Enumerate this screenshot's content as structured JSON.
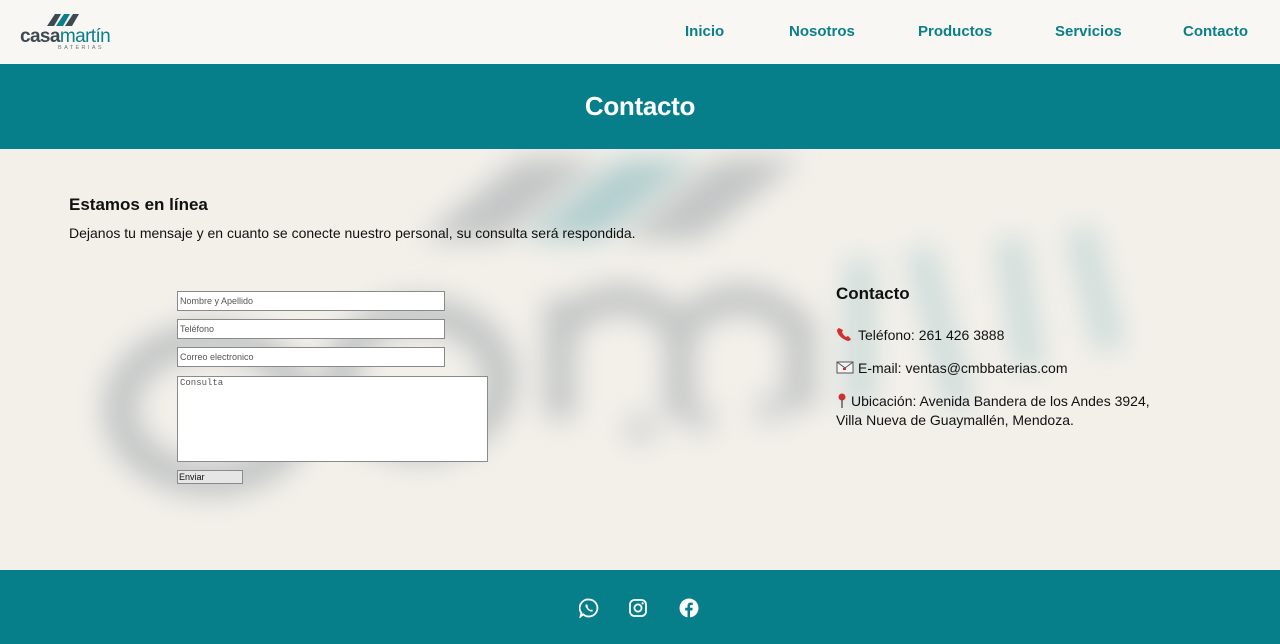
{
  "header": {
    "logo": {
      "name": "logo-casamartin",
      "word_main": "casa",
      "word_accent": "martín",
      "sub": "BATERIAS"
    },
    "nav": [
      {
        "label": "Inicio"
      },
      {
        "label": "Nosotros"
      },
      {
        "label": "Productos"
      },
      {
        "label": "Servicios"
      },
      {
        "label": "Contacto"
      }
    ]
  },
  "hero": {
    "title": "Contacto"
  },
  "intro": {
    "heading": "Estamos en línea",
    "text": "Dejanos tu mensaje y en cuanto se conecte nuestro personal, su consulta será respondida."
  },
  "form": {
    "name_placeholder": "Nombre y Apellido",
    "phone_placeholder": "Teléfono",
    "email_placeholder": "Correo electronico",
    "message_placeholder": "Consulta",
    "submit_label": "Enviar"
  },
  "contact": {
    "heading": "Contacto",
    "phone": "Teléfono: 261 426 3888",
    "email": "E-mail: ventas@cmbbaterias.com",
    "address_line1": "Ubicación: Avenida Bandera de los Andes 3924,",
    "address_line2": "Villa Nueva de Guaymallén, Mendoza."
  },
  "footer": {
    "social": [
      {
        "icon": "whatsapp-icon"
      },
      {
        "icon": "instagram-icon"
      },
      {
        "icon": "facebook-icon"
      }
    ]
  },
  "colors": {
    "brand": "#077f8b",
    "nav": "#0a7f8c",
    "background": "#f3f0ea",
    "logo_dark": "#3d4a52"
  }
}
